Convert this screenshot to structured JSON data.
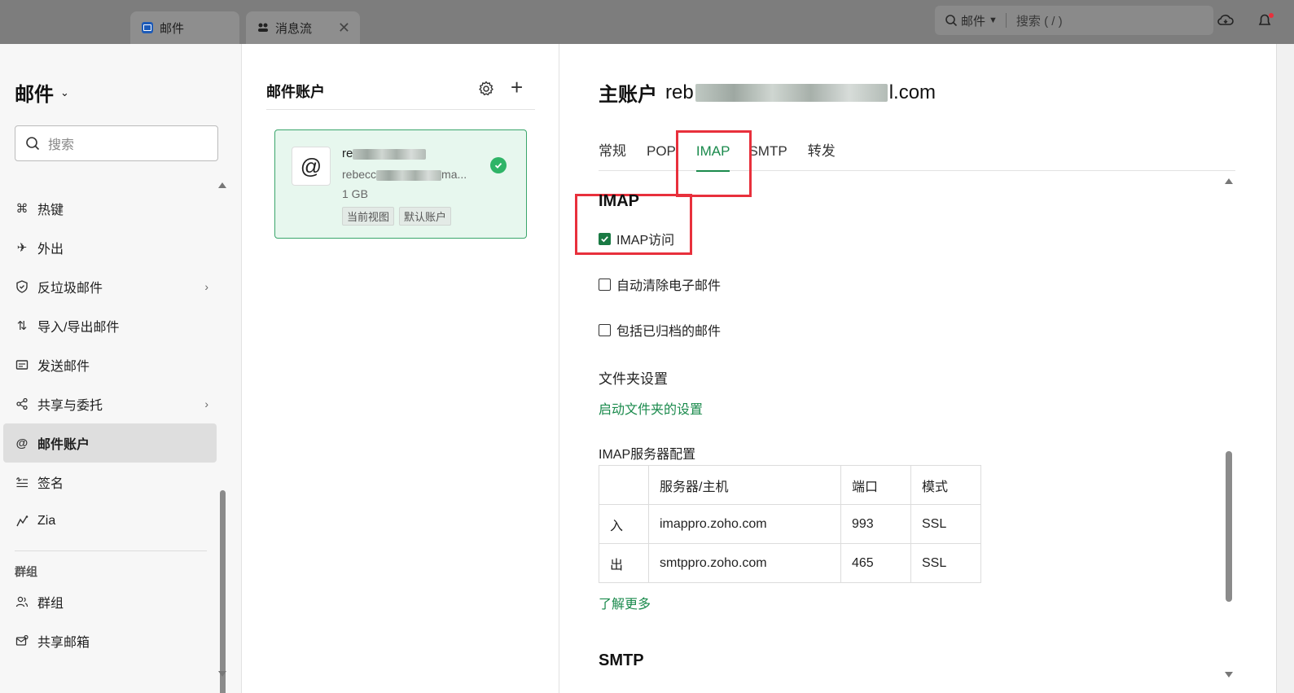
{
  "browser_tabs": [
    {
      "label": "邮件"
    },
    {
      "label": "消息流"
    }
  ],
  "topbar": {
    "search_scope": "邮件",
    "search_placeholder": "搜索 ( / )"
  },
  "sidebar": {
    "app_title": "邮件",
    "search_placeholder": "搜索",
    "items": [
      {
        "label": "热键",
        "icon": "command-icon"
      },
      {
        "label": "外出",
        "icon": "airplane-icon"
      },
      {
        "label": "反垃圾邮件",
        "icon": "shield-check-icon"
      },
      {
        "label": "导入/导出邮件",
        "icon": "import-export-icon"
      },
      {
        "label": "发送邮件",
        "icon": "send-mail-icon"
      },
      {
        "label": "共享与委托",
        "icon": "share-icon"
      },
      {
        "label": "邮件账户",
        "icon": "at-icon"
      },
      {
        "label": "签名",
        "icon": "signature-icon"
      },
      {
        "label": "Zia",
        "icon": "zia-icon"
      }
    ],
    "group_label": "群组",
    "group_items": [
      {
        "label": "群组",
        "icon": "group-icon"
      },
      {
        "label": "共享邮箱",
        "icon": "shared-mailbox-icon"
      }
    ]
  },
  "accounts_panel": {
    "title": "邮件账户",
    "card": {
      "avatar": "@",
      "name_prefix": "re",
      "email_prefix": "rebecc",
      "email_suffix": "ma...",
      "size": "1 GB",
      "tags": [
        "当前视图",
        "默认账户"
      ]
    }
  },
  "settings": {
    "heading_label": "主账户",
    "email_prefix": "reb",
    "email_suffix": "l.com",
    "tabs": [
      "常规",
      "POP",
      "IMAP",
      "SMTP",
      "转发"
    ],
    "active_tab": "IMAP",
    "imap_title": "IMAP",
    "imap_access": {
      "label": "IMAP访问",
      "checked": true
    },
    "auto_expunge": {
      "label": "自动清除电子邮件",
      "checked": false
    },
    "include_archived": {
      "label": "包括已归档的邮件",
      "checked": false
    },
    "folder_settings_title": "文件夹设置",
    "folder_settings_link": "启动文件夹的设置",
    "server_config_title": "IMAP服务器配置",
    "server_table": {
      "headers": [
        "",
        "服务器/主机",
        "端口",
        "模式"
      ],
      "rows": [
        [
          "入",
          "imappro.zoho.com",
          "993",
          "SSL"
        ],
        [
          "出",
          "smtppro.zoho.com",
          "465",
          "SSL"
        ]
      ]
    },
    "learn_more": "了解更多",
    "smtp_title": "SMTP"
  },
  "colors": {
    "accent": "#1a8a4c",
    "highlight": "#e8303c",
    "active_card_bg": "#e7f7ee"
  }
}
